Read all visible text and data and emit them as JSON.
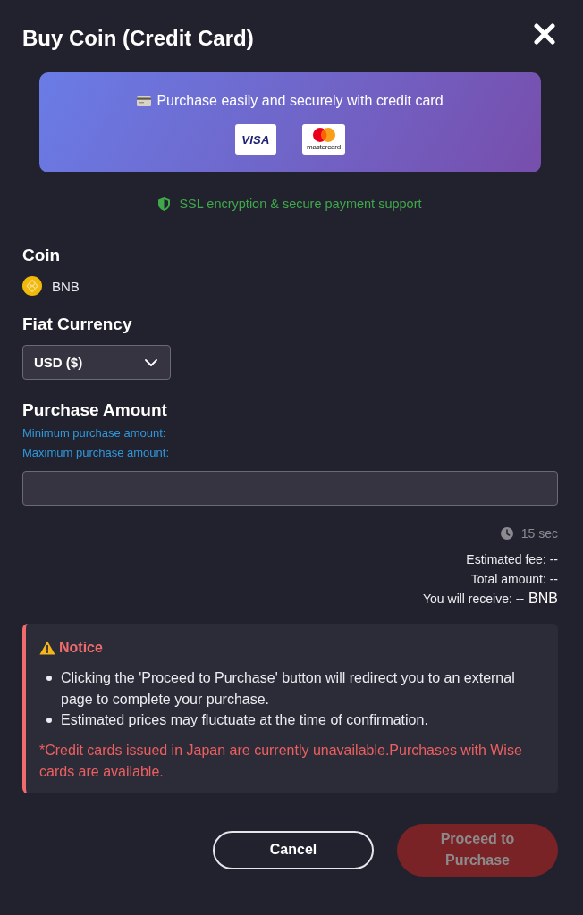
{
  "dialog": {
    "title": "Buy Coin (Credit Card)"
  },
  "banner": {
    "text": "Purchase easily and securely with credit card",
    "card_brands": [
      {
        "kind": "visa",
        "label": "VISA"
      },
      {
        "kind": "mastercard",
        "label": "mastercard"
      }
    ]
  },
  "security_note": "SSL encryption & secure payment support",
  "coin": {
    "label": "Coin",
    "value": "BNB"
  },
  "fiat_currency": {
    "label": "Fiat Currency",
    "value": "USD ($)"
  },
  "purchase_amount": {
    "label": "Purchase Amount",
    "limits": [
      "Minimum purchase amount:",
      "Maximum purchase amount:"
    ]
  },
  "quote": {
    "refresh": "15 sec",
    "lines": [
      {
        "text": "Estimated fee: --"
      },
      {
        "text": "Total amount: --"
      },
      {
        "text": "You will receive: --",
        "unit": "BNB"
      }
    ]
  },
  "notice": {
    "title": "Notice",
    "items": [
      "Clicking the 'Proceed to Purchase' button will redirect you to an external page to complete your purchase.",
      "Estimated prices may fluctuate at the time of confirmation."
    ],
    "warning": "*Credit cards issued in Japan are currently unavailable.Purchases with Wise cards are available."
  },
  "buttons": [
    {
      "kind": "cancel",
      "label": "Cancel",
      "disabled": false
    },
    {
      "kind": "proceed",
      "label": "Proceed to Purchase",
      "disabled": true
    }
  ]
}
